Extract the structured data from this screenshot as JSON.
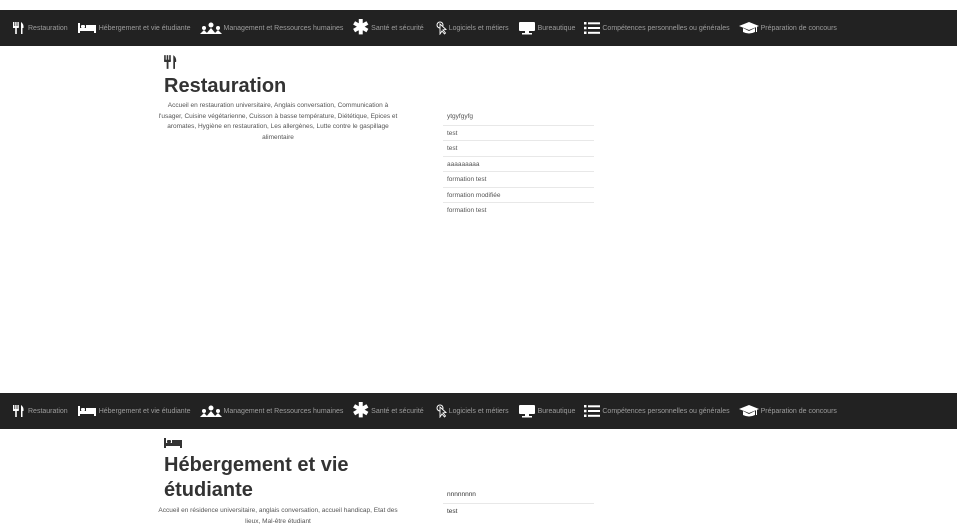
{
  "nav": {
    "items": [
      {
        "label": "Restauration",
        "icon": "fork-knife-icon"
      },
      {
        "label": "Hébergement et vie étudiante",
        "icon": "bed-icon"
      },
      {
        "label": "Management et Ressources humaines",
        "icon": "management-icon"
      },
      {
        "label": "Santé et sécurité",
        "icon": "asterisk-icon"
      },
      {
        "label": "Logiciels et métiers",
        "icon": "cursor-icon"
      },
      {
        "label": "Bureautique",
        "icon": "monitor-icon"
      },
      {
        "label": "Compétences personnelles ou générales",
        "icon": "list-icon"
      },
      {
        "label": "Préparation de concours",
        "icon": "graduation-cap-icon"
      }
    ]
  },
  "sections": [
    {
      "title": "Restauration",
      "icon": "fork-knife-icon",
      "description": "Accueil en restauration universitaire, Anglais conversation, Communication à l'usager, Cuisine végétarienne, Cuisson à basse température, Diététique, Epices et aromates, Hygiène en restauration, Les allergènes, Lutte contre le gaspillage alimentaire",
      "formations": [
        "ytgyfgyfg",
        "test",
        "test",
        "aaaaaaaaa",
        "formation test",
        "formation modifiée",
        "formation test"
      ]
    },
    {
      "title": "Hébergement et vie étudiante",
      "icon": "bed-icon",
      "description": "Accueil en résidence universitaire, anglais conversation, accueil handicap, Etat des lieux, Mal-être étudiant",
      "formations": [
        "nnnnnnnn",
        "test"
      ]
    }
  ],
  "colors": {
    "navbar": "#222222",
    "nav_text": "#9d9d9d",
    "nav_icon": "#ffffff",
    "title": "#333333"
  }
}
